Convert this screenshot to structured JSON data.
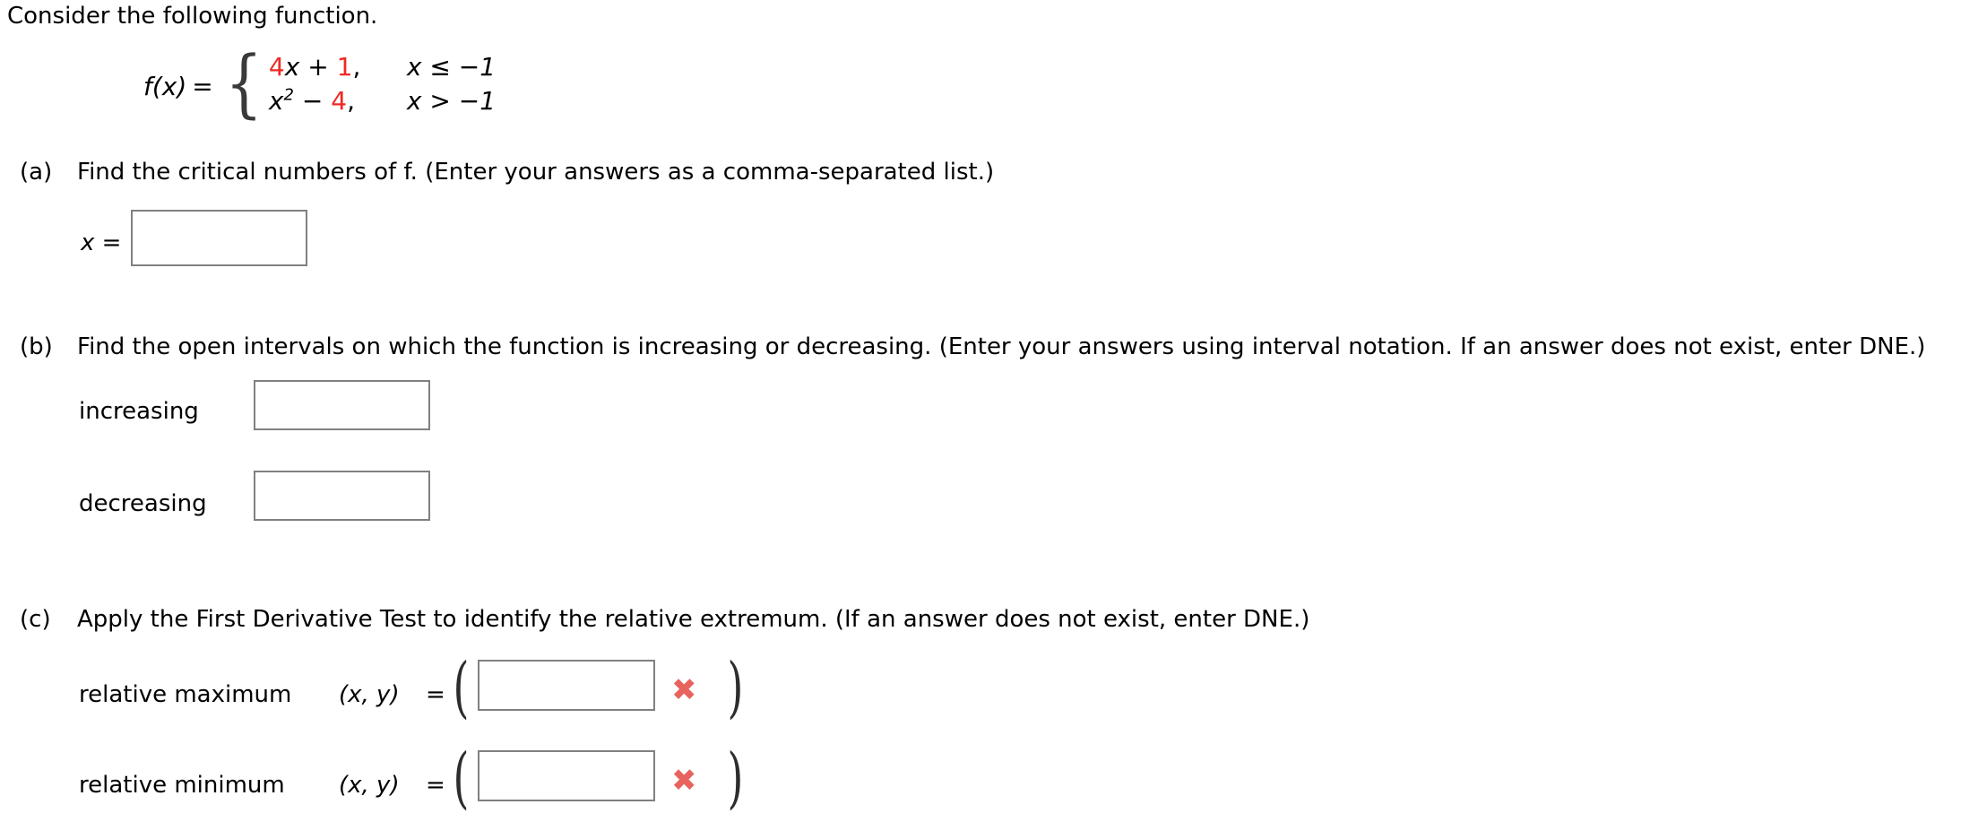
{
  "intro": "Consider the following function.",
  "formula": {
    "fname": "f(x)",
    "equals": "=",
    "case1": {
      "coef": "4",
      "var": "x",
      "plus": "+",
      "const": "1",
      "comma": ",",
      "condition": "x ≤ −1"
    },
    "case2": {
      "var": "x",
      "exponent": "2",
      "minus": "−",
      "const": "4",
      "comma": ",",
      "condition": "x > −1"
    }
  },
  "parts": {
    "a": {
      "label": "(a)",
      "text": "Find the critical numbers of f. (Enter your answers as a comma-separated list.)",
      "input_label": "x =",
      "input_value": "",
      "input_placeholder": ""
    },
    "b": {
      "label": "(b)",
      "text": "Find the open intervals on which the function is increasing or decreasing. (Enter your answers using interval notation. If an answer does not exist, enter DNE.)",
      "increasing_label": "increasing",
      "increasing_value": "",
      "decreasing_label": "decreasing",
      "decreasing_value": ""
    },
    "c": {
      "label": "(c)",
      "text": "Apply the First Derivative Test to identify the relative extremum. (If an answer does not exist, enter DNE.)",
      "max_label": "relative maximum",
      "max_coord": "(x, y)",
      "max_equals": "=",
      "max_value": "",
      "max_status_icon": "✖",
      "min_label": "relative minimum",
      "min_coord": "(x, y)",
      "min_equals": "=",
      "min_value": "",
      "min_status_icon": "✖",
      "open_paren": "(",
      "close_paren": ")"
    }
  },
  "colors": {
    "highlight_red": "#ee2a24",
    "incorrect_mark": "#e8635e",
    "input_border": "#808080",
    "text": "#000000",
    "background": "#ffffff"
  }
}
